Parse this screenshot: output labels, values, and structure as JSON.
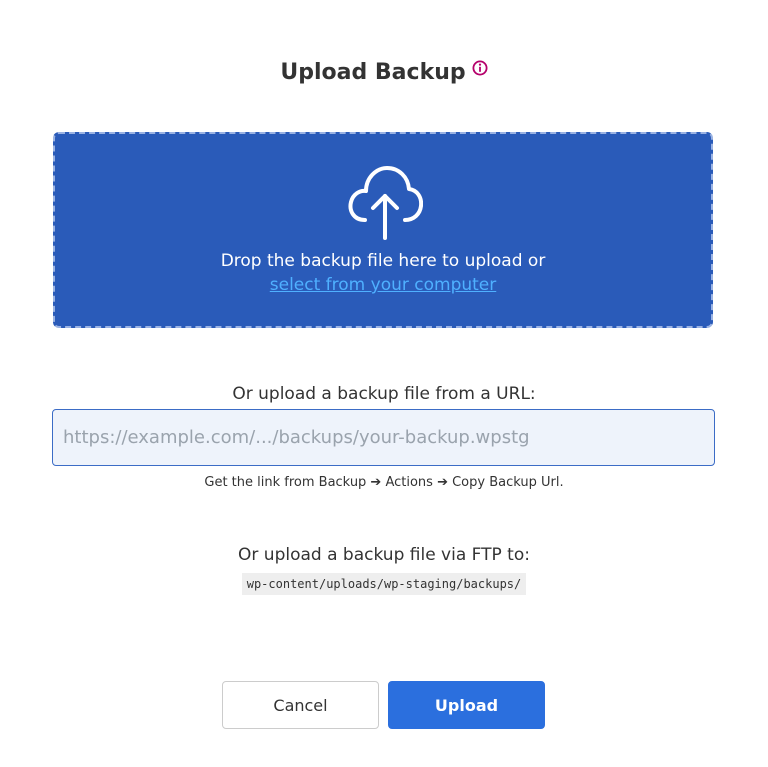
{
  "dialog": {
    "title": "Upload Backup",
    "info_icon": "info-circle-icon",
    "accent_color": "#b5006b"
  },
  "dropzone": {
    "icon": "cloud-upload-icon",
    "text": "Drop the backup file here to upload or",
    "link_text": "select from your computer",
    "background_color": "#2a5bb9"
  },
  "url_upload": {
    "label": "Or upload a backup file from a URL:",
    "value": "",
    "placeholder": "https://example.com/.../backups/your-backup.wpstg",
    "hint": "Get the link from Backup ➔ Actions ➔ Copy Backup Url."
  },
  "ftp_upload": {
    "label": "Or upload a backup file via FTP to:",
    "path": "wp-content/uploads/wp-staging/backups/"
  },
  "buttons": {
    "cancel_label": "Cancel",
    "upload_label": "Upload",
    "upload_color": "#2b6fde"
  }
}
